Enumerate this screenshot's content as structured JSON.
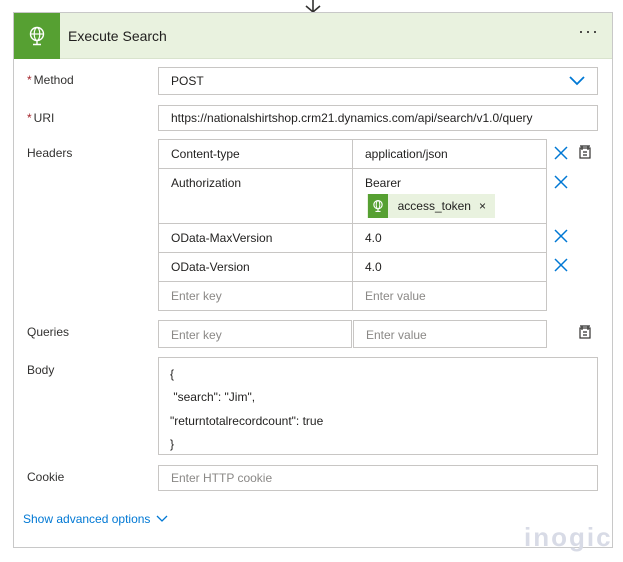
{
  "step": {
    "title": "Execute Search",
    "more_label": "···",
    "icon": "globe-icon",
    "header_bg": "#e9f2df",
    "icon_bg": "#56a032"
  },
  "method": {
    "required_mark": "*",
    "label": "Method",
    "value": "POST"
  },
  "uri": {
    "required_mark": "*",
    "label": "URI",
    "value": "https://nationalshirtshop.crm21.dynamics.com/api/search/v1.0/query"
  },
  "headers": {
    "label": "Headers",
    "rows": [
      {
        "key": "Content-type",
        "value": "application/json"
      },
      {
        "key": "Authorization",
        "value": "Bearer",
        "token": "access_token",
        "token_remove": "×"
      },
      {
        "key": "OData-MaxVersion",
        "value": "4.0"
      },
      {
        "key": "OData-Version",
        "value": "4.0"
      }
    ],
    "key_placeholder": "Enter key",
    "value_placeholder": "Enter value"
  },
  "queries": {
    "label": "Queries",
    "key_placeholder": "Enter key",
    "value_placeholder": "Enter value"
  },
  "body": {
    "label": "Body",
    "lines": [
      "{",
      " \"search\": \"Jim\",",
      "\"returntotalrecordcount\": true",
      "}"
    ]
  },
  "cookie": {
    "label": "Cookie",
    "placeholder": "Enter HTTP cookie"
  },
  "advanced": {
    "label": "Show advanced options"
  },
  "watermark": "inogic",
  "colors": {
    "link": "#0078d4",
    "accent_green": "#56a032",
    "required": "#a4262c"
  }
}
